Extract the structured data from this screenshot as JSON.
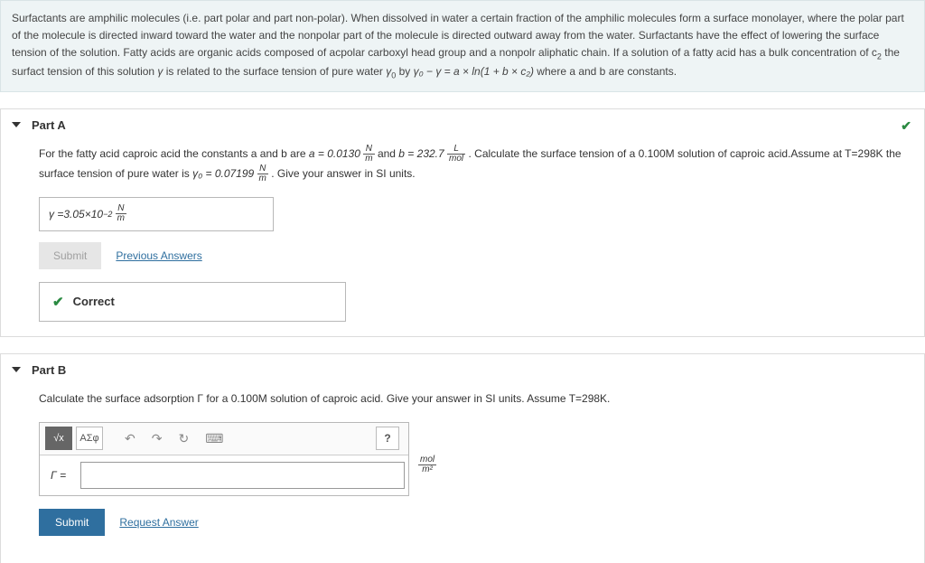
{
  "intro": {
    "prefix": "Surfactants are amphilic molecules (i.e. part polar and part non-polar). When dissolved in water a certain fraction of the amphilic molecules form a surface monolayer, where the polar part of the molecule is directed inward toward the water and the nonpolar part of the molecule is directed outward away from the water. Surfactants have the effect of lowering the surface tension of the solution. Fatty acids are organic acids composed of acpolar carboxyl head group and a nonpolr aliphatic chain. If a solution of a fatty acid has a bulk concentration of c",
    "sub1": "2",
    "mid1": " the surfact tension of this solution ",
    "g1": "γ",
    "mid2": " is related to the surface tension of pure water ",
    "g0": "γ",
    "sub0": "0",
    "mid3": " by ",
    "eq": "γ₀ − γ = a × ln(1 + b × c₂)",
    "suffix": " where a and b are constants."
  },
  "partA": {
    "title": "Part A",
    "q_pre": "For the fatty acid caproic acid the constants a and b are ",
    "a_eq": "a = 0.0130",
    "a_unit_n": "N",
    "a_unit_d": "m",
    "q_mid1": " and ",
    "b_eq": "b = 232.7",
    "b_unit_n": "L",
    "b_unit_d": "mol",
    "q_mid2": " . Calculate the surface tension of a 0.100M solution of caproic acid.Assume at T=298K the surface tension of pure water is ",
    "g0_eq": "γ₀ = 0.07199",
    "g0_unit_n": "N",
    "g0_unit_d": "m",
    "q_end": " . Give your answer in SI units.",
    "ans_lhs": "γ = ",
    "ans_val": "3.05×10",
    "ans_exp": "−2",
    "ans_unit_n": "N",
    "ans_unit_d": "m",
    "submit": "Submit",
    "prev": "Previous Answers",
    "correct": "Correct"
  },
  "partB": {
    "title": "Part B",
    "q": "Calculate the surface adsorption Γ for a 0.100M solution of caproic acid. Give your answer in SI units. Assume T=298K.",
    "tb1": "√x",
    "tb2": "ΑΣφ",
    "undo": "↶",
    "redo": "↷",
    "reset": "↻",
    "kbd": "⌨",
    "help": "?",
    "lhs": "Γ =",
    "unit_n": "mol",
    "unit_d": "m²",
    "submit": "Submit",
    "request": "Request Answer"
  }
}
